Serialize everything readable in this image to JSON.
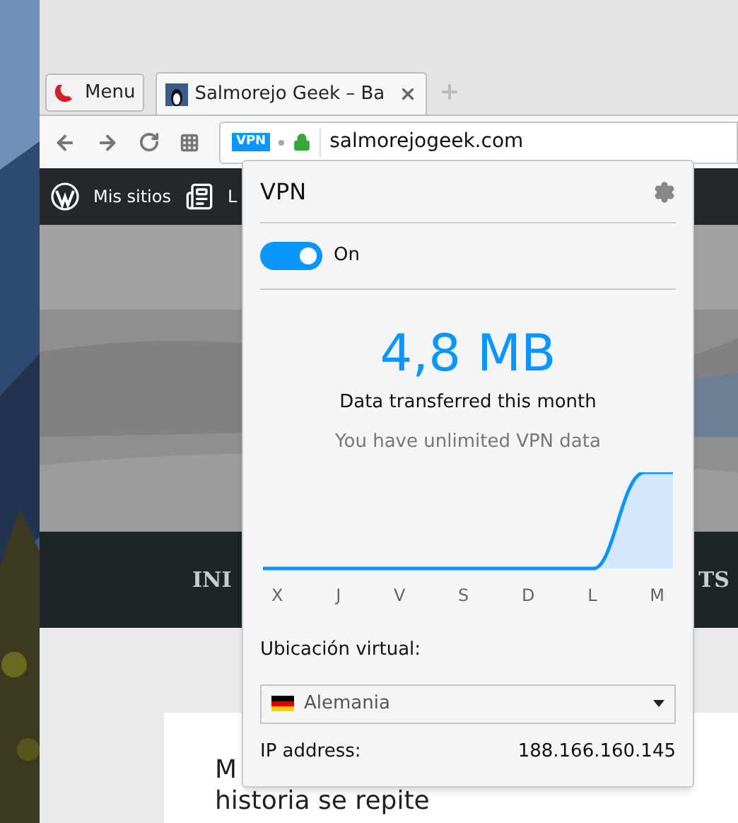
{
  "browser": {
    "menu_button": "Menu",
    "tabs": [
      {
        "title": "Salmorejo Geek – Ba",
        "selected": true
      }
    ],
    "address": {
      "badge": "VPN",
      "url": "salmorejogeek.com"
    }
  },
  "admin_bar": {
    "items": [
      "Mis sitios",
      "L"
    ]
  },
  "site": {
    "nav_left": "INI",
    "nav_right": "TS",
    "post_title_lines": [
      "M",
      "historia se repite"
    ]
  },
  "vpn_popup": {
    "title": "VPN",
    "toggle": {
      "label": "On",
      "on": true
    },
    "amount": "4,8 MB",
    "amount_caption": "Data transferred this month",
    "note": "You have unlimited VPN data",
    "chart_days": [
      "X",
      "J",
      "V",
      "S",
      "D",
      "L",
      "M"
    ],
    "location_label": "Ubicación virtual:",
    "location": "Alemania",
    "ip_label": "IP address:",
    "ip": "188.166.160.145"
  }
}
